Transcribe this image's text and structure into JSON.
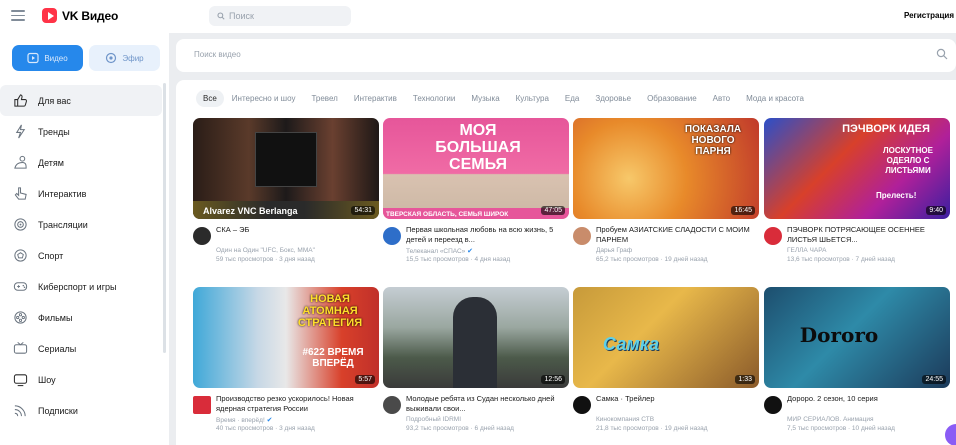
{
  "header": {
    "logo_text": "VK Видео",
    "search_placeholder": "Поиск",
    "register_label": "Регистрация"
  },
  "sidebar": {
    "mode_video": "Видео",
    "mode_live": "Эфир",
    "items": [
      {
        "label": "Для вас",
        "icon": "thumbs-up-icon"
      },
      {
        "label": "Тренды",
        "icon": "trending-icon"
      },
      {
        "label": "Детям",
        "icon": "kids-icon"
      },
      {
        "label": "Интерактив",
        "icon": "pointer-icon"
      },
      {
        "label": "Трансляции",
        "icon": "broadcast-icon"
      },
      {
        "label": "Спорт",
        "icon": "ball-icon"
      },
      {
        "label": "Киберспорт и игры",
        "icon": "gamepad-icon"
      },
      {
        "label": "Фильмы",
        "icon": "film-icon"
      },
      {
        "label": "Сериалы",
        "icon": "tv-series-icon"
      },
      {
        "label": "Шоу",
        "icon": "screen-icon"
      },
      {
        "label": "Подписки",
        "icon": "subscriptions-icon"
      }
    ]
  },
  "search": {
    "placeholder": "Поиск видео"
  },
  "categories": [
    "Все",
    "Интересно и шоу",
    "Тревел",
    "Интерактив",
    "Технологии",
    "Музыка",
    "Культура",
    "Еда",
    "Здоровье",
    "Образование",
    "Авто",
    "Мода и красота"
  ],
  "videos": [
    {
      "title": "СКА – ЭБ",
      "channel": "Один на Один \"UFC, Бокс, ММА\"",
      "verified": false,
      "meta": "59 тыс просмотров · 3 дня назад",
      "duration": "54:31",
      "thumb_text": "Alvarez VNC Berlanga"
    },
    {
      "title": "Первая школьная любовь на всю жизнь, 5 детей и переезд в...",
      "channel": "Телеканал «СПАС»",
      "verified": true,
      "meta": "15,5 тыс просмотров · 4 дня назад",
      "duration": "47:05",
      "thumb_text": "МОЯ БОЛЬШАЯ СЕМЬЯ",
      "thumb_sub": "ТВЕРСКАЯ ОБЛАСТЬ, СЕМЬЯ ШИРОК"
    },
    {
      "title": "Пробуем АЗИАТСКИЕ СЛАДОСТИ С МОИМ ПАРНЕМ",
      "channel": "Дарья Граф",
      "verified": false,
      "meta": "65,2 тыс просмотров · 19 дней назад",
      "duration": "16:45",
      "thumb_text": "ПОКАЗАЛА НОВОГО ПАРНЯ"
    },
    {
      "title": "ПЭЧВОРК ПОТРЯСАЮЩЕЕ ОСЕННЕЕ ЛИСТЬЯ ШЬЕТСЯ...",
      "channel": "ГЕЛЛА ЧАРА",
      "verified": false,
      "meta": "13,6 тыс просмотров · 7 дней назад",
      "duration": "9:40",
      "thumb_text": "ПЭЧВОРК ИДЕЯ",
      "thumb_sub": "ЛОСКУТНОЕ ОДЕЯЛО С ЛИСТЬЯМИ",
      "thumb_extra": "Прелесть!"
    },
    {
      "title": "Производство резко ускорилось! Новая ядерная стратегия России",
      "channel": "Время · вперёд!",
      "verified": true,
      "meta": "40 тыс просмотров · 3 дня назад",
      "duration": "5:57",
      "thumb_text": "НОВАЯ АТОМНАЯ СТРАТЕГИЯ",
      "thumb_sub": "#622 ВРЕМЯ ВПЕРЁД"
    },
    {
      "title": "Молодые ребята из Судан несколько дней выживали свои...",
      "channel": "Подробный IDRMI",
      "verified": false,
      "meta": "93,2 тыс просмотров · 6 дней назад",
      "duration": "12:56",
      "thumb_text": ""
    },
    {
      "title": "Самка · Трейлер",
      "channel": "Кинокомпания СТВ",
      "verified": false,
      "meta": "21,8 тыс просмотров · 19 дней назад",
      "duration": "1:33",
      "thumb_text": "Самка"
    },
    {
      "title": "Дороро. 2 сезон, 10 серия",
      "channel": "МИР СЕРИАЛОВ. Анимация",
      "verified": false,
      "meta": "7,5 тыс просмотров · 10 дней назад",
      "duration": "24:55",
      "thumb_text": "Dororo"
    }
  ],
  "colors": {
    "accent": "#2688eb",
    "logo": "#ff3347"
  }
}
